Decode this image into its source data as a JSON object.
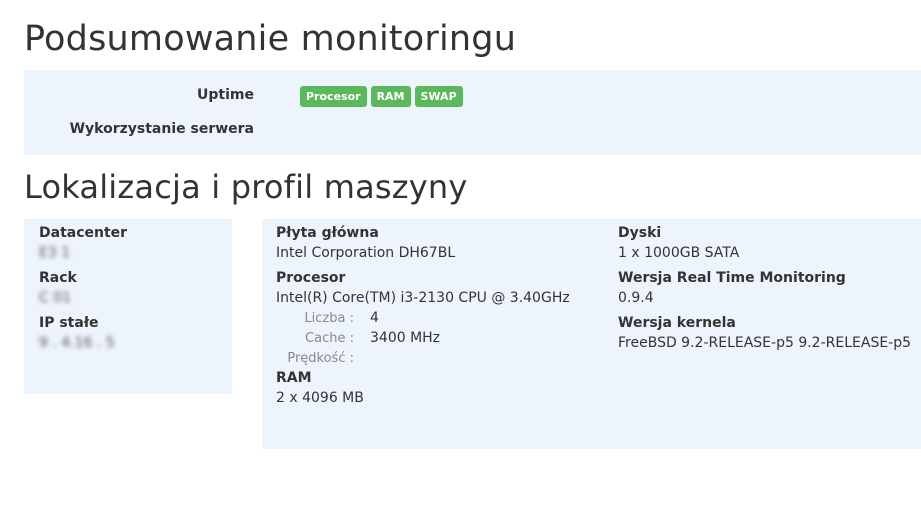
{
  "summary": {
    "title": "Podsumowanie monitoringu",
    "uptime_label": "Uptime",
    "usage_label": "Wykorzystanie serwera",
    "badges": [
      "Procesor",
      "RAM",
      "SWAP"
    ],
    "badge_color": "#5cb85c"
  },
  "location": {
    "title": "Lokalizacja i profil maszyny",
    "datacenter_label": "Datacenter",
    "datacenter_value": "E3 1",
    "rack_label": "Rack",
    "rack_value": "C 01",
    "ip_label": "IP stałe",
    "ip_value": "9 . 4.16 . 5"
  },
  "profile": {
    "motherboard_label": "Płyta główna",
    "motherboard_value": "Intel Corporation DH67BL",
    "cpu_label": "Procesor",
    "cpu_value": "Intel(R) Core(TM) i3-2130 CPU @ 3.40GHz",
    "cpu_count_label": "Liczba :",
    "cpu_count_value": "4",
    "cpu_cache_label": "Cache :",
    "cpu_cache_value": "3400 MHz",
    "cpu_speed_label": "Prędkość :",
    "cpu_speed_value": "",
    "ram_label": "RAM",
    "ram_value": "2 x 4096 MB",
    "disks_label": "Dyski",
    "disks_value": "1 x 1000GB SATA",
    "rtm_label": "Wersja Real Time Monitoring",
    "rtm_value": "0.9.4",
    "kernel_label": "Wersja kernela",
    "kernel_value": "FreeBSD 9.2-RELEASE-p5 9.2-RELEASE-p5"
  },
  "colors": {
    "panel_bg": "#eef4fc",
    "text": "#333333"
  }
}
